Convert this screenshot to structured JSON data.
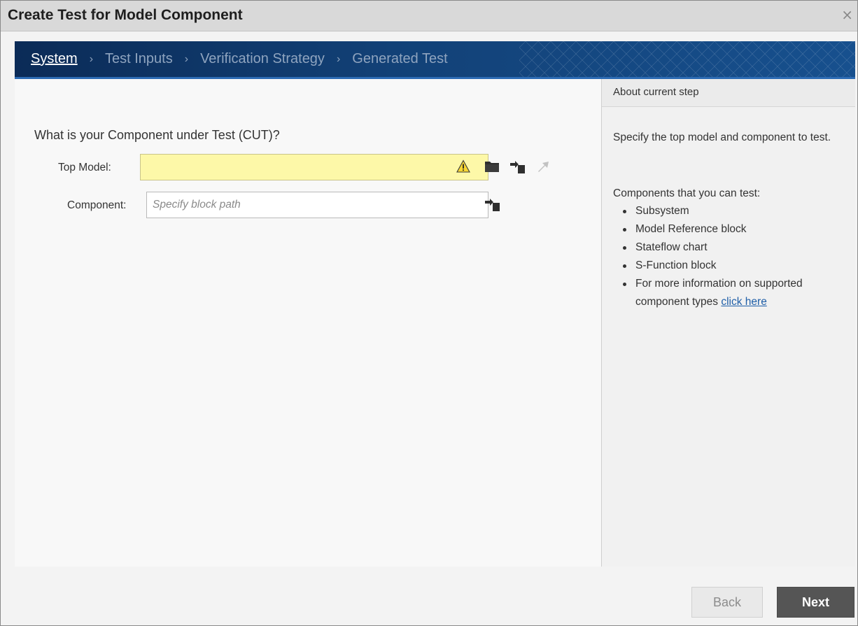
{
  "window": {
    "title": "Create Test for Model Component",
    "close_glyph": "×"
  },
  "steps": [
    {
      "label": "System",
      "active": true
    },
    {
      "label": "Test Inputs",
      "active": false
    },
    {
      "label": "Verification Strategy",
      "active": false
    },
    {
      "label": "Generated Test",
      "active": false
    }
  ],
  "step_separator": "›",
  "main": {
    "question": "What is your Component under Test (CUT)?",
    "top_model": {
      "label": "Top Model:",
      "value": "",
      "placeholder": "",
      "status": "warning"
    },
    "component": {
      "label": "Component:",
      "value": "",
      "placeholder": "Specify block path"
    }
  },
  "side": {
    "header": "About current step",
    "description": "Specify the top model and component to test.",
    "subheading": "Components that you can test:",
    "items": [
      "Subsystem",
      "Model Reference block",
      "Stateflow chart",
      "S-Function block"
    ],
    "more_info_prefix": "For more information on supported component types",
    "more_info_link": "click here"
  },
  "footer": {
    "back_label": "Back",
    "next_label": "Next"
  },
  "colors": {
    "warning_field": "#fdf8a8",
    "step_active": "#ffffff",
    "step_inactive": "#8fa4bf",
    "next_button": "#555555"
  }
}
